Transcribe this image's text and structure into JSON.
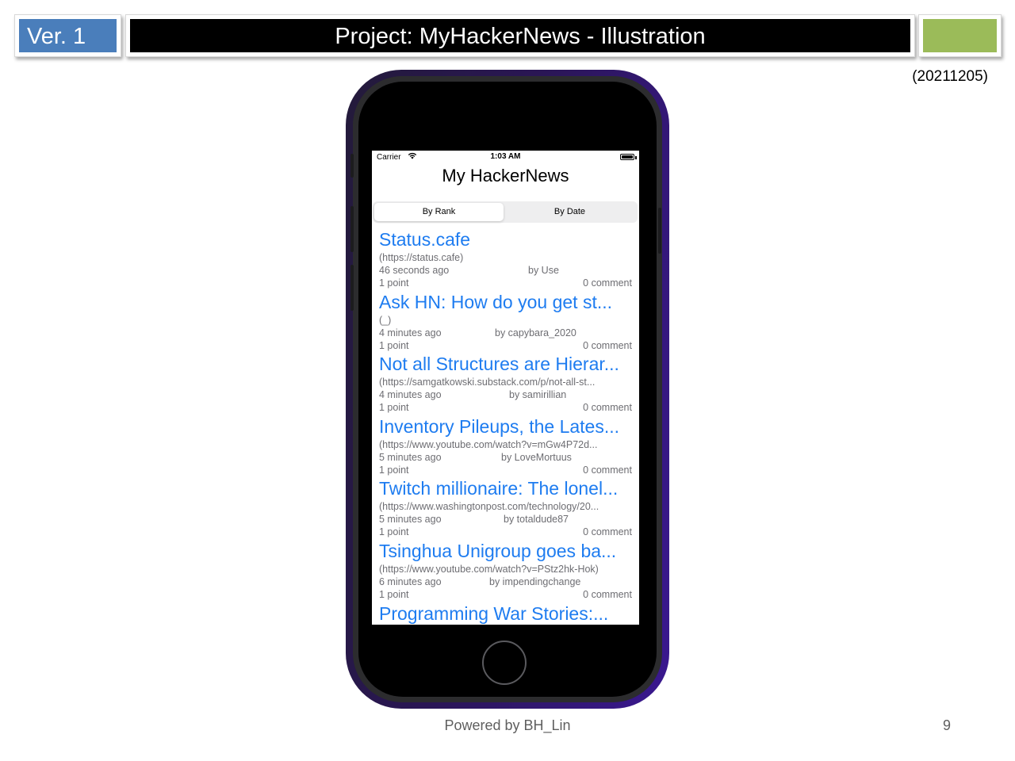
{
  "slide": {
    "version": "Ver. 1",
    "title": "Project: MyHackerNews - Illustration",
    "date": "(20211205)",
    "footer": "Powered by BH_Lin",
    "page_number": "9"
  },
  "status_bar": {
    "carrier": "Carrier",
    "time": "1:03 AM"
  },
  "app": {
    "title": "My HackerNews",
    "segments": [
      "By Rank",
      "By Date"
    ],
    "selected_segment": "By Rank"
  },
  "news": [
    {
      "title": "Status.cafe",
      "url": "(https://status.cafe)",
      "time": "46 seconds ago",
      "author": "by Use",
      "points": "1 point",
      "comments": "0 comment"
    },
    {
      "title": "Ask HN: How do you get st...",
      "url": "(_)",
      "time": "4 minutes ago",
      "author": "by capybara_2020",
      "points": "1 point",
      "comments": "0 comment"
    },
    {
      "title": "Not all Structures are Hierar...",
      "url": "(https://samgatkowski.substack.com/p/not-all-st...",
      "time": "4 minutes ago",
      "author": "by samirillian",
      "points": "1 point",
      "comments": "0 comment"
    },
    {
      "title": "Inventory Pileups, the Lates...",
      "url": "(https://www.youtube.com/watch?v=mGw4P72d...",
      "time": "5 minutes ago",
      "author": "by LoveMortuus",
      "points": "1 point",
      "comments": "0 comment"
    },
    {
      "title": "Twitch millionaire: The lonel...",
      "url": "(https://www.washingtonpost.com/technology/20...",
      "time": "5 minutes ago",
      "author": "by totaldude87",
      "points": "1 point",
      "comments": "0 comment"
    },
    {
      "title": "Tsinghua Unigroup goes ba...",
      "url": "(https://www.youtube.com/watch?v=PStz2hk-Hok)",
      "time": "6 minutes ago",
      "author": "by impendingchange",
      "points": "1 point",
      "comments": "0 comment"
    },
    {
      "title": "Programming War Stories:...",
      "url": "",
      "time": "",
      "author": "",
      "points": "",
      "comments": ""
    }
  ]
}
